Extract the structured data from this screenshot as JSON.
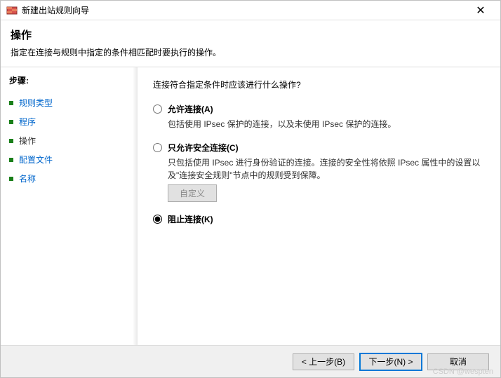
{
  "titlebar": {
    "title": "新建出站规则向导",
    "close": "✕"
  },
  "header": {
    "title": "操作",
    "desc": "指定在连接与规则中指定的条件相匹配时要执行的操作。"
  },
  "sidebar": {
    "label": "步骤:",
    "steps": [
      {
        "label": "规则类型",
        "active": false
      },
      {
        "label": "程序",
        "active": false
      },
      {
        "label": "操作",
        "active": true
      },
      {
        "label": "配置文件",
        "active": false
      },
      {
        "label": "名称",
        "active": false
      }
    ]
  },
  "content": {
    "question": "连接符合指定条件时应该进行什么操作?",
    "options": [
      {
        "id": "allow",
        "label": "允许连接(A)",
        "desc": "包括使用 IPsec 保护的连接，以及未使用 IPsec 保护的连接。",
        "checked": false
      },
      {
        "id": "secure",
        "label": "只允许安全连接(C)",
        "desc": "只包括使用 IPsec 进行身份验证的连接。连接的安全性将依照 IPsec 属性中的设置以及\"连接安全规则\"节点中的规则受到保障。",
        "checked": false,
        "customBtn": "自定义"
      },
      {
        "id": "block",
        "label": "阻止连接(K)",
        "desc": "",
        "checked": true
      }
    ]
  },
  "footer": {
    "back": "< 上一步(B)",
    "next": "下一步(N) >",
    "cancel": "取消"
  },
  "watermark": "CSDN @wespten"
}
